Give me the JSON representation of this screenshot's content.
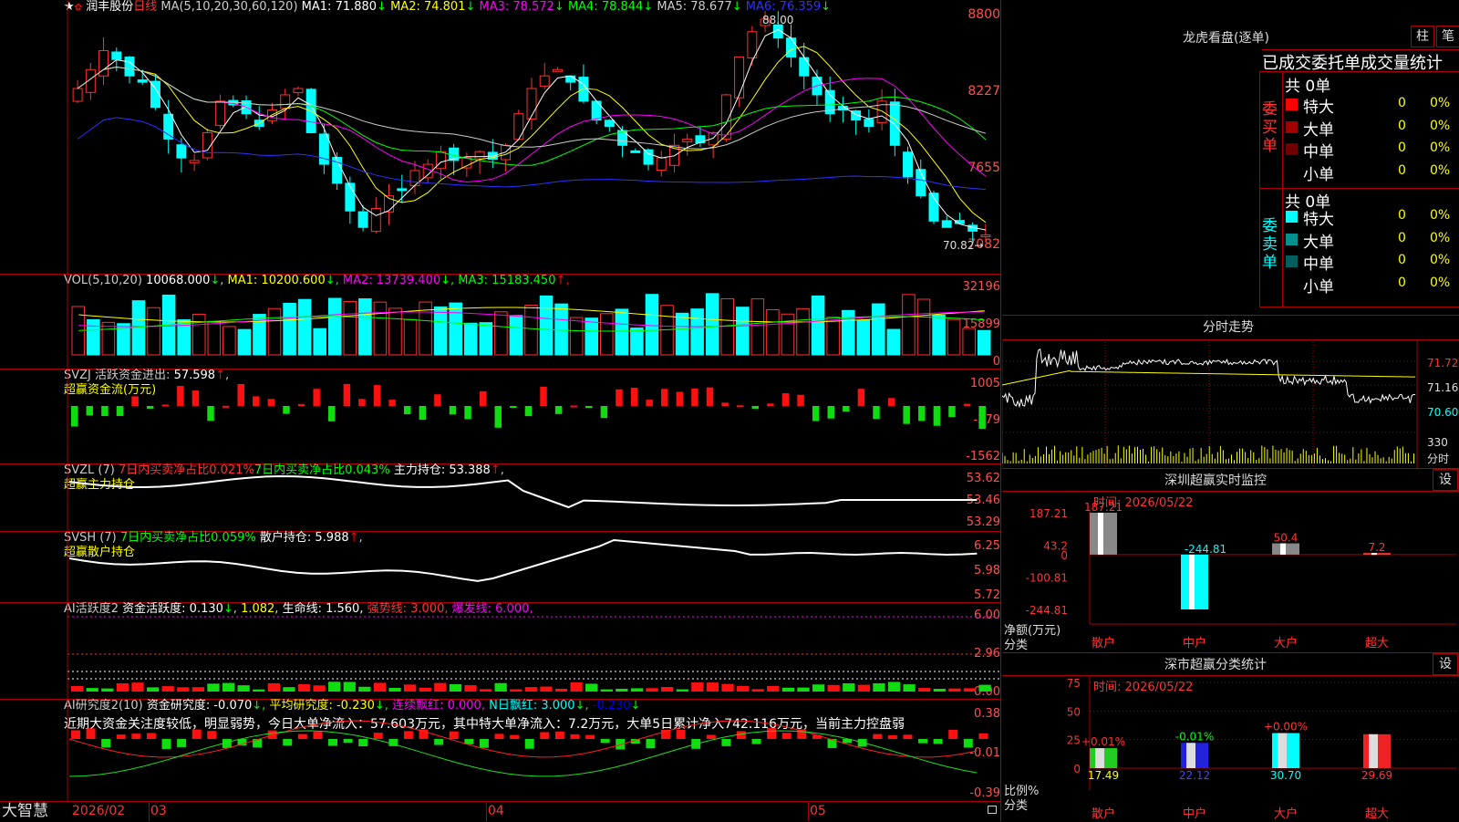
{
  "header": {
    "star": "★",
    "stock_name": "润丰股份",
    "period": "日线",
    "ma_params": "MA(5,10,20,30,60,120)",
    "ma": [
      {
        "label": "MA1:",
        "value": "71.880",
        "arrow": "↓",
        "color": "#ffffff"
      },
      {
        "label": "MA2:",
        "value": "74.801",
        "arrow": "↓",
        "color": "#ffff00"
      },
      {
        "label": "MA3:",
        "value": "78.572",
        "arrow": "↓",
        "color": "#ff00ff"
      },
      {
        "label": "MA4:",
        "value": "78.844",
        "arrow": "↓",
        "color": "#00ff00"
      },
      {
        "label": "MA5:",
        "value": "78.677",
        "arrow": "↓",
        "color": "#cccccc"
      },
      {
        "label": "MA6:",
        "value": "76.359",
        "arrow": "↓",
        "color": "#3030ff"
      }
    ]
  },
  "price_axis": [
    "8800",
    "8227",
    "7655",
    "7082"
  ],
  "price_marks": {
    "high": "88.00",
    "low": "70.82"
  },
  "vol": {
    "label": "VOL(5,10,20)",
    "value": "10068.000",
    "arrow": "↓",
    "ma": [
      {
        "label": "MA1:",
        "value": "10200.600",
        "arrow": "↓",
        "color": "#ffff00"
      },
      {
        "label": "MA2:",
        "value": "13739.400",
        "arrow": "↓",
        "color": "#ff00ff"
      },
      {
        "label": "MA3:",
        "value": "15183.450",
        "arrow": "↑",
        "color": "#00ff00"
      }
    ],
    "axis": [
      "32196",
      "15899",
      "0"
    ]
  },
  "svzj": {
    "label": "SVZJ",
    "text": "活跃资金进出:",
    "value": "57.598",
    "arrow": "↑",
    "sub": "超赢资金流(万元)",
    "axis": [
      "1005",
      "-279",
      "-1562"
    ]
  },
  "svzl": {
    "label": "SVZL (7)",
    "p1": "7日内买卖净占比0.021%",
    "p2": "7日内买卖净占比0.043%",
    "p3": "主力持仓:",
    "value": "53.388",
    "arrow": "↑",
    "sub": "超赢主力持仓",
    "axis": [
      "53.62",
      "53.46",
      "53.29"
    ]
  },
  "svsh": {
    "label": "SVSH (7)",
    "p1": "7日内买卖净占比0.059%",
    "p2": "散户持仓:",
    "value": "5.988",
    "arrow": "↑",
    "sub": "超赢散户持仓",
    "axis": [
      "6.25",
      "5.98",
      "5.72"
    ]
  },
  "ai2": {
    "label": "AI活跃度2",
    "p1": "资金活跃度:",
    "v1": "0.130",
    "a1": "↓",
    "v2": "1.082,",
    "p3": "生命线:",
    "v3": "1.560,",
    "p4": "强势线:",
    "v4": "3.000,",
    "p5": "爆发线:",
    "v5": "6.000,",
    "axis": [
      "6.00",
      "2.96",
      "0.00"
    ]
  },
  "ai_research": {
    "label": "AI研究度2(10)",
    "p1": "资金研究度:",
    "v1": "-0.070",
    "a1": "↓,",
    "p2": "平均研究度:",
    "v2": "-0.230",
    "a2": "↓,",
    "p3": "连续飘红:",
    "v3": "0.000,",
    "p4": "N日飘红:",
    "v4": "3.000",
    "a4": "↓,",
    "v5": "-0.230",
    "a5": "↓",
    "comment": "近期大资金关注度较低，明显弱势，今日大单净流入：57.603万元，其中特大单净流入：7.2万元，大单5日累计净入742.116万元，当前主力控盘弱",
    "axis": [
      "0.38",
      "-0.01",
      "-0.39"
    ]
  },
  "footer": {
    "brand": "大智慧",
    "dates": [
      "2026/02",
      "03",
      "04",
      "05"
    ]
  },
  "longhu": {
    "title": "龙虎看盘(逐单)",
    "btn1": "柱",
    "btn2": "笔",
    "header": "已成交委托单成交量统计",
    "buy": {
      "side": "委买单",
      "total": "共 0单",
      "rows": [
        {
          "name": "特大",
          "v": "0",
          "p": "0%",
          "color": "#ff0000"
        },
        {
          "name": "大单",
          "v": "0",
          "p": "0%",
          "color": "#a00000"
        },
        {
          "name": "中单",
          "v": "0",
          "p": "0%",
          "color": "#700000"
        },
        {
          "name": "小单",
          "v": "0",
          "p": "0%",
          "color": "#000000"
        }
      ]
    },
    "sell": {
      "side": "委卖单",
      "total": "共 0单",
      "rows": [
        {
          "name": "特大",
          "v": "0",
          "p": "0%",
          "color": "#00ffff"
        },
        {
          "name": "大单",
          "v": "0",
          "p": "0%",
          "color": "#009090"
        },
        {
          "name": "中单",
          "v": "0",
          "p": "0%",
          "color": "#006060"
        },
        {
          "name": "小单",
          "v": "0",
          "p": "0%",
          "color": "#000000"
        }
      ]
    }
  },
  "intraday": {
    "title": "分时走势",
    "axis": [
      "71.72",
      "71.16",
      "70.60"
    ],
    "vol_label": "330",
    "vol_unit": "分时"
  },
  "monitor": {
    "title": "深圳超赢实时监控",
    "btn": "设",
    "time": "时间: 2026/05/22",
    "axis": [
      "187.21",
      "43.2",
      "0",
      "-100.81",
      "-244.81"
    ],
    "ylabel": "净额(万元)",
    "xlabel": "分类",
    "values_label": [
      "187.21",
      "-244.81",
      "50.4",
      "7.2"
    ]
  },
  "classify": {
    "title": "深市超赢分类统计",
    "btn": "设",
    "time": "时间: 2026/05/22",
    "axis": [
      "75",
      "50",
      "25",
      "0"
    ],
    "ylabel": "比例%",
    "xlabel": "分类",
    "diff": [
      "+0.01%",
      "-0.01%",
      "+0.00%",
      ""
    ],
    "vals": [
      "17.49",
      "22.12",
      "30.70",
      "29.69"
    ]
  },
  "chart_data": {
    "type": "bar",
    "title": "深圳超赢实时监控",
    "categories": [
      "散户",
      "中户",
      "大户",
      "超大"
    ],
    "series": [
      {
        "name": "净额(万元)",
        "values": [
          187.21,
          -244.81,
          50.4,
          7.2
        ]
      }
    ],
    "ylabel": "净额(万元)",
    "xlabel": "分类",
    "ylim": [
      -244.81,
      187.21
    ]
  },
  "chart_data_classify": {
    "type": "bar",
    "categories": [
      "散户",
      "中户",
      "大户",
      "超大"
    ],
    "values": [
      17.49,
      22.12,
      30.7,
      29.69
    ],
    "ylabel": "比例%",
    "xlabel": "分类",
    "ylim": [
      0,
      75
    ]
  }
}
